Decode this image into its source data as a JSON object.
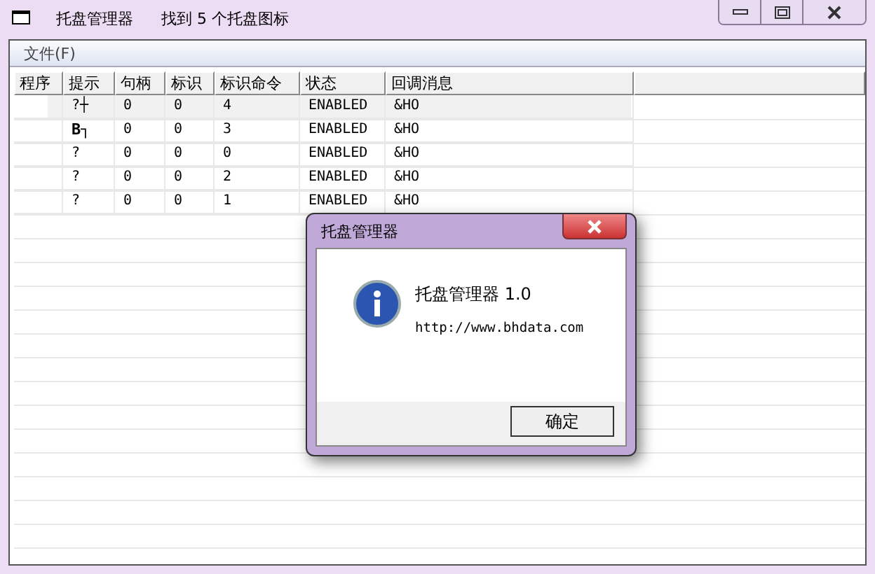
{
  "window": {
    "title": "托盘管理器",
    "status_text": "找到 5 个托盘图标"
  },
  "menu": [
    {
      "label": "文件(F)"
    }
  ],
  "table": {
    "columns": [
      "程序",
      "提示",
      "句柄",
      "标识",
      "标识命令",
      "状态",
      "回调消息"
    ],
    "rows": [
      {
        "cells": [
          "",
          "?┼",
          "0",
          "0",
          "4",
          "ENABLED",
          "&HO"
        ],
        "selected": true
      },
      {
        "cells": [
          "",
          "B┐",
          "0",
          "0",
          "3",
          "ENABLED",
          "&HO"
        ],
        "selected": false
      },
      {
        "cells": [
          "",
          "?",
          "0",
          "0",
          "0",
          "ENABLED",
          "&HO"
        ],
        "selected": false
      },
      {
        "cells": [
          "",
          "?",
          "0",
          "0",
          "2",
          "ENABLED",
          "&HO"
        ],
        "selected": false
      },
      {
        "cells": [
          "",
          "?",
          "0",
          "0",
          "1",
          "ENABLED",
          "&HO"
        ],
        "selected": false
      }
    ]
  },
  "dialog": {
    "title": "托盘管理器",
    "message": "托盘管理器 1.0",
    "url": "http://www.bhdata.com",
    "button": "确定"
  }
}
